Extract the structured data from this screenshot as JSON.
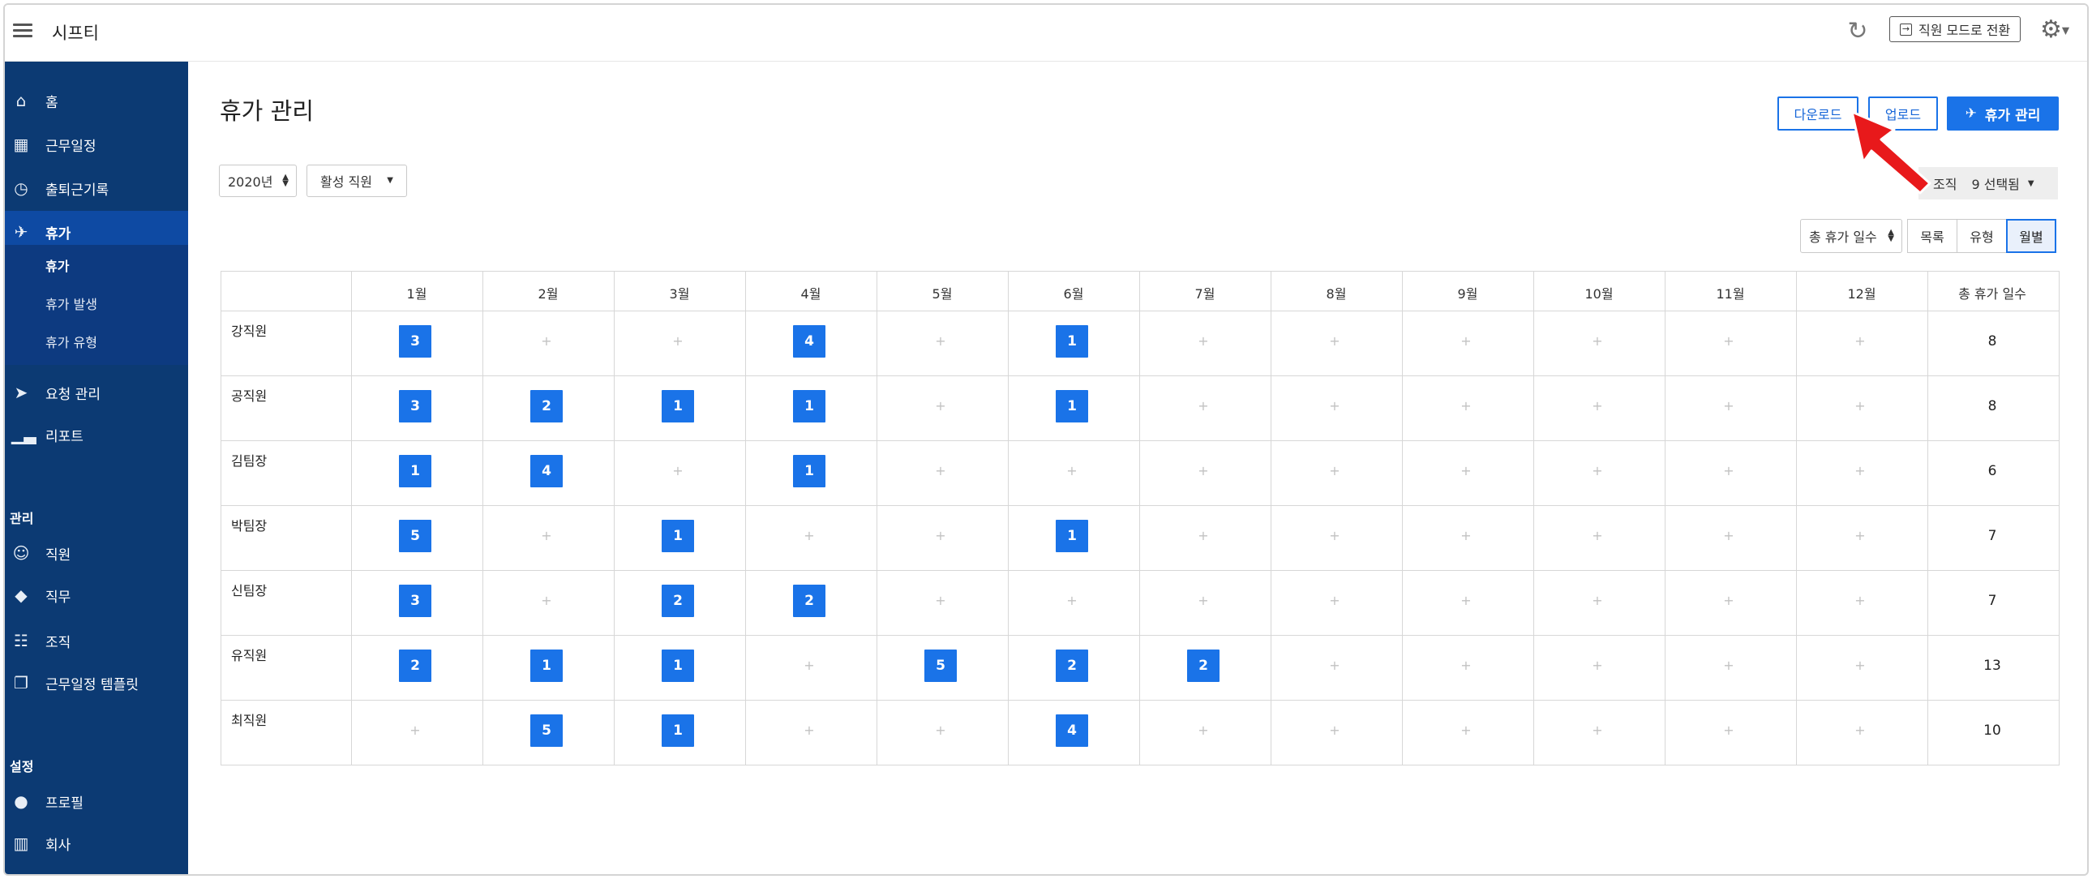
{
  "app": {
    "title": "시프티"
  },
  "header": {
    "switch_mode_label": "직원 모드로 전환",
    "refresh_icon": "refresh-icon",
    "settings_icon": "gear-icon"
  },
  "sidebar": {
    "items": [
      {
        "label": "홈",
        "icon": "home-icon"
      },
      {
        "label": "근무일정",
        "icon": "calendar-icon"
      },
      {
        "label": "출퇴근기록",
        "icon": "clock-icon"
      },
      {
        "label": "휴가",
        "icon": "airplane-icon"
      },
      {
        "label": "요청 관리",
        "icon": "paper-plane-icon"
      },
      {
        "label": "리포트",
        "icon": "chart-icon"
      }
    ],
    "sub_items": [
      "휴가",
      "휴가 발생",
      "휴가 유형"
    ],
    "section_manage": "관리",
    "manage_items": [
      {
        "label": "직원",
        "icon": "users-icon"
      },
      {
        "label": "직무",
        "icon": "tags-icon"
      },
      {
        "label": "조직",
        "icon": "sitemap-icon"
      },
      {
        "label": "근무일정 템플릿",
        "icon": "copy-icon"
      }
    ],
    "section_settings": "설정",
    "settings_items": [
      {
        "label": "프로필",
        "icon": "user-icon"
      },
      {
        "label": "회사",
        "icon": "building-icon"
      }
    ]
  },
  "main": {
    "page_title": "휴가 관리",
    "download_label": "다운로드",
    "upload_label": "업로드",
    "manage_label": "휴가 관리",
    "year_select": "2020년",
    "status_select": "활성 직원",
    "org_filter_label": "조직",
    "org_filter_value": "9 선택됨",
    "metric_select": "총 휴가 일수",
    "views": [
      "목록",
      "유형",
      "월별"
    ],
    "active_view": "월별"
  },
  "table": {
    "months": [
      "1월",
      "2월",
      "3월",
      "4월",
      "5월",
      "6월",
      "7월",
      "8월",
      "9월",
      "10월",
      "11월",
      "12월"
    ],
    "total_header": "총 휴가 일수",
    "empty_symbol": "+",
    "rows": [
      {
        "name": "강직원",
        "values": [
          3,
          null,
          null,
          4,
          null,
          1,
          null,
          null,
          null,
          null,
          null,
          null
        ],
        "total": "8"
      },
      {
        "name": "공직원",
        "values": [
          3,
          2,
          1,
          1,
          null,
          1,
          null,
          null,
          null,
          null,
          null,
          null
        ],
        "total": "8"
      },
      {
        "name": "김팀장",
        "values": [
          1,
          4,
          null,
          1,
          null,
          null,
          null,
          null,
          null,
          null,
          null,
          null
        ],
        "total": "6"
      },
      {
        "name": "박팀장",
        "values": [
          5,
          null,
          1,
          null,
          null,
          1,
          null,
          null,
          null,
          null,
          null,
          null
        ],
        "total": "7"
      },
      {
        "name": "신팀장",
        "values": [
          3,
          null,
          2,
          2,
          null,
          null,
          null,
          null,
          null,
          null,
          null,
          null
        ],
        "total": "7"
      },
      {
        "name": "유직원",
        "values": [
          2,
          1,
          1,
          null,
          5,
          2,
          2,
          null,
          null,
          null,
          null,
          null
        ],
        "total": "13"
      },
      {
        "name": "최직원",
        "values": [
          null,
          5,
          1,
          null,
          null,
          4,
          null,
          null,
          null,
          null,
          null,
          null
        ],
        "total": "10"
      }
    ]
  },
  "colors": {
    "sidebar": "#0c3a73",
    "accent": "#1a73e8",
    "annotation": "#e8191b"
  }
}
